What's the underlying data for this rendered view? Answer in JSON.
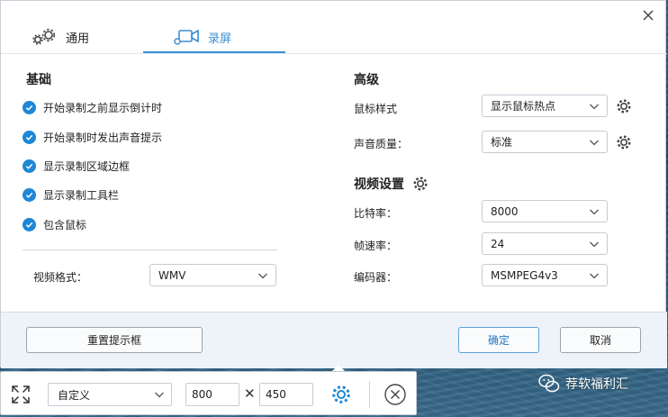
{
  "tabs": [
    {
      "label": "通用",
      "icon": "gear-pair-icon",
      "active": false
    },
    {
      "label": "录屏",
      "icon": "video-camera-icon",
      "active": true
    }
  ],
  "basic": {
    "title": "基础",
    "options": [
      {
        "label": "开始录制之前显示倒计时",
        "checked": true
      },
      {
        "label": "开始录制时发出声音提示",
        "checked": true
      },
      {
        "label": "显示录制区域边框",
        "checked": true
      },
      {
        "label": "显示录制工具栏",
        "checked": true
      },
      {
        "label": "包含鼠标",
        "checked": true
      }
    ],
    "video_format_label": "视频格式：",
    "video_format_value": "WMV"
  },
  "advanced": {
    "title": "高级",
    "mouse_style_label": "鼠标样式",
    "mouse_style_value": "显示鼠标热点",
    "audio_quality_label": "声音质量：",
    "audio_quality_value": "标准"
  },
  "video_settings": {
    "title": "视频设置",
    "bitrate_label": "比特率：",
    "bitrate_value": "8000",
    "framerate_label": "帧速率：",
    "framerate_value": "24",
    "encoder_label": "编码器：",
    "encoder_value": "MSMPEG4v3"
  },
  "footer": {
    "reset_label": "重置提示框",
    "ok_label": "确定",
    "cancel_label": "取消"
  },
  "toolbar": {
    "preset_value": "自定义",
    "width_value": "800",
    "height_value": "450",
    "times_symbol": "✕"
  },
  "watermark": {
    "text": "荐软福利汇"
  },
  "colors": {
    "accent": "#3b8fd4",
    "check": "#1e87d6",
    "footer_bg": "#edf3f9"
  }
}
